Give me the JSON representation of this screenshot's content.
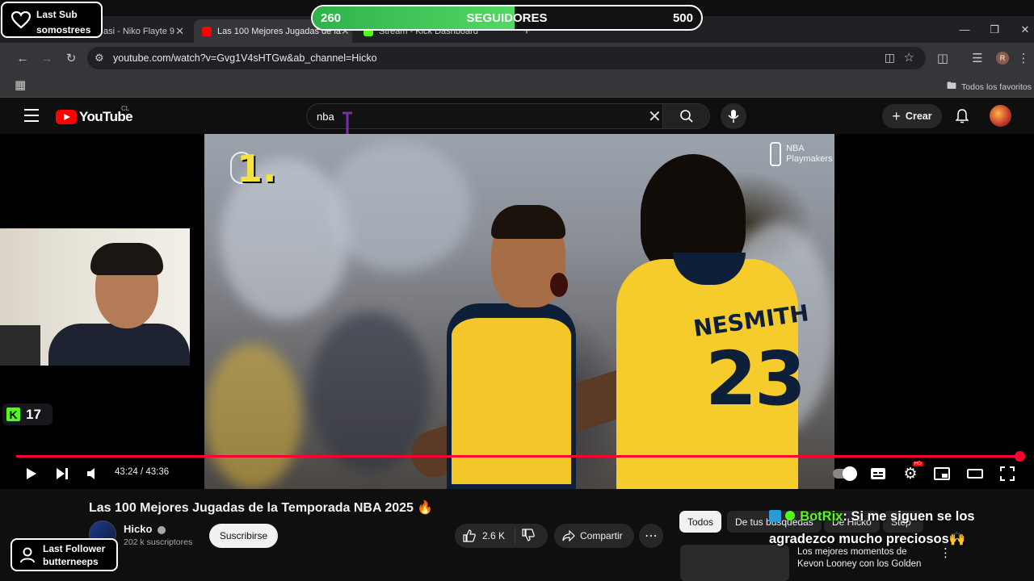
{
  "browser": {
    "tabs": [
      {
        "title": "asi - Niko Flayte 9",
        "close": "✕"
      },
      {
        "title": "Las 100 Mejores Jugadas de la",
        "close": "✕"
      },
      {
        "title": "Stream - Kick Dashboard",
        "close": ""
      }
    ],
    "new_tab": "+",
    "url": "youtube.com/watch?v=Gvg1V4sHTGw&ab_channel=Hicko",
    "bookmarks_folder": "Todos los favoritos",
    "profile_initial": "R"
  },
  "youtube": {
    "logo_text": "YouTube",
    "country": "CL",
    "search_value": "nba",
    "create_label": "Crear"
  },
  "video": {
    "rank_label": "1.",
    "watermark_line1": "NBA",
    "watermark_line2": "Playmakers",
    "jersey_name": "NESMITH",
    "jersey_number": "23",
    "current_time": "43:24",
    "duration": "43:36",
    "time_display": "43:24 / 43:36",
    "progress_fraction": 0.995,
    "hd_badge": "HD"
  },
  "meta": {
    "title": "Las 100 Mejores Jugadas de la Temporada NBA 2025 🔥",
    "channel_name": "Hicko",
    "subscribers": "202 k suscriptores",
    "subscribe_label": "Suscribirse",
    "likes": "2.6 K",
    "share_label": "Compartir"
  },
  "chips": [
    {
      "label": "Todos",
      "selected": true
    },
    {
      "label": "De tus búsquedas",
      "selected": false
    },
    {
      "label": "De Hicko",
      "selected": false
    },
    {
      "label": "Step",
      "selected": false
    }
  ],
  "recommendation": {
    "line1": "Los mejores momentos de",
    "line2": "Kevon Looney con los Golden"
  },
  "overlay": {
    "last_sub_line1": "Last Sub",
    "last_sub_line2": "somostrees",
    "followers_current": "260",
    "followers_label": "SEGUIDORES",
    "followers_goal": "500",
    "followers_fraction": 0.52,
    "viewer_count": "17",
    "kick_letter": "K",
    "last_follower_line1": "Last Follower",
    "last_follower_line2": "butterneeps",
    "chat_user": "BotRix",
    "chat_text": ": Si me siguen se los agradezco mucho preciosos🙌"
  },
  "colors": {
    "yt_red": "#ff0000",
    "progress_red": "#ff0033",
    "kick_green": "#53fc18",
    "followers_green": "#2fb24a",
    "jersey_yellow": "#f6cb2c",
    "jersey_navy": "#0e1f3a"
  }
}
